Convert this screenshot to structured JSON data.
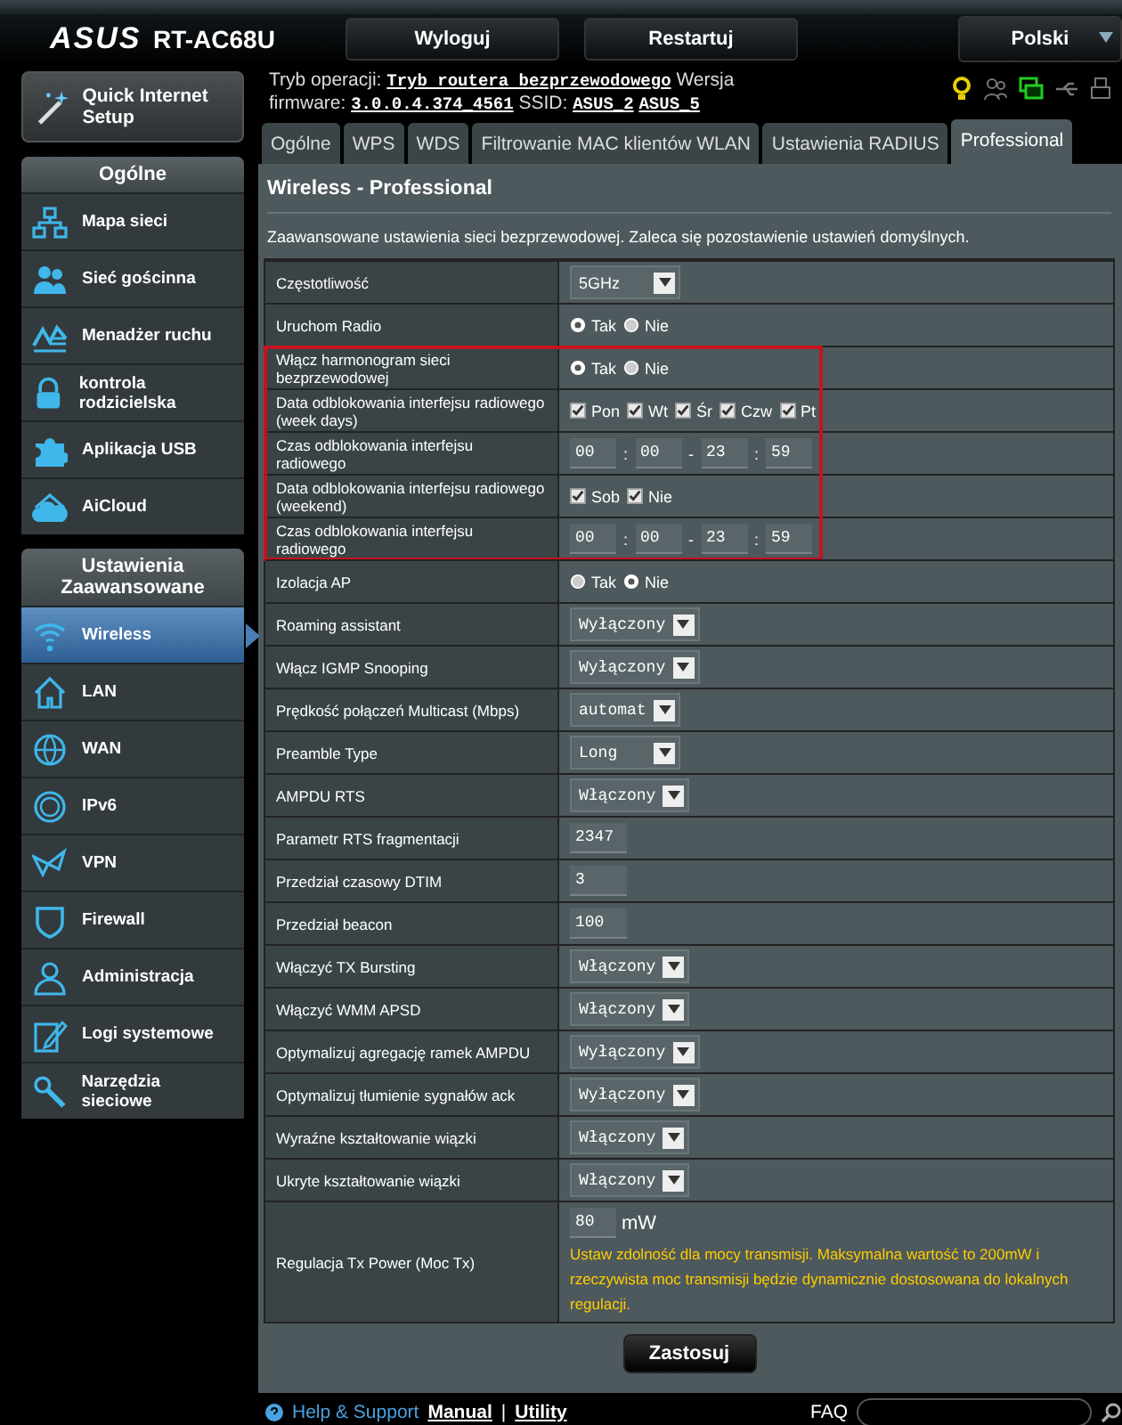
{
  "header": {
    "logo": "ASUS",
    "model": "RT-AC68U",
    "buttons": [
      "Wyloguj",
      "Restartuj"
    ],
    "language": "Polski"
  },
  "info": {
    "mode_label": "Tryb operacji:",
    "mode": "Tryb routera bezprzewodowego",
    "firmware_label_1": "Wersja",
    "firmware_label_2": "firmware:",
    "firmware": "3.0.0.4.374_4561",
    "ssid_label": "SSID:",
    "ssids": [
      "ASUS_2",
      "ASUS_5"
    ]
  },
  "sidebar": {
    "quick_setup": "Quick Internet Setup",
    "sections": [
      {
        "title": "Ogólne",
        "items": [
          {
            "label": "Mapa sieci",
            "selected": false
          },
          {
            "label": "Sieć gościnna",
            "selected": false
          },
          {
            "label": "Menadżer ruchu",
            "selected": false
          },
          {
            "label": "kontrola rodzicielska",
            "selected": false
          },
          {
            "label": "Aplikacja USB",
            "selected": false
          },
          {
            "label": "AiCloud",
            "selected": false
          }
        ]
      },
      {
        "title": "Ustawienia Zaawansowane",
        "items": [
          {
            "label": "Wireless",
            "selected": true
          },
          {
            "label": "LAN",
            "selected": false
          },
          {
            "label": "WAN",
            "selected": false
          },
          {
            "label": "IPv6",
            "selected": false
          },
          {
            "label": "VPN",
            "selected": false
          },
          {
            "label": "Firewall",
            "selected": false
          },
          {
            "label": "Administracja",
            "selected": false
          },
          {
            "label": "Logi systemowe",
            "selected": false
          },
          {
            "label": "Narzędzia sieciowe",
            "selected": false
          }
        ]
      }
    ]
  },
  "tabs": [
    {
      "label": "Ogólne",
      "selected": false
    },
    {
      "label": "WPS",
      "selected": false
    },
    {
      "label": "WDS",
      "selected": false
    },
    {
      "label": "Filtrowanie MAC klientów WLAN",
      "selected": false
    },
    {
      "label": "Ustawienia RADIUS",
      "selected": false
    },
    {
      "label": "Professional",
      "selected": true
    }
  ],
  "page": {
    "title": "Wireless - Professional",
    "description": "Zaawansowane ustawienia sieci bezprzewodowej. Zaleca się pozostawienie ustawień domyślnych.",
    "settings": [
      {
        "label": "Częstotliwość",
        "kind": "select",
        "value": "5GHz",
        "mono": false,
        "highlighted": false
      },
      {
        "label": "Uruchom Radio",
        "kind": "radio",
        "options": [
          {
            "label": "Tak",
            "selected": true
          },
          {
            "label": "Nie",
            "selected": false
          }
        ],
        "highlighted": false
      },
      {
        "label": "Włącz harmonogram sieci bezprzewodowej",
        "kind": "radio",
        "options": [
          {
            "label": "Tak",
            "selected": true
          },
          {
            "label": "Nie",
            "selected": false
          }
        ],
        "highlighted": true
      },
      {
        "label": "Data odblokowania interfejsu radiowego (week days)",
        "kind": "checks",
        "options": [
          {
            "label": "Pon",
            "checked": true
          },
          {
            "label": "Wt",
            "checked": true
          },
          {
            "label": "Śr",
            "checked": true
          },
          {
            "label": "Czw",
            "checked": true
          },
          {
            "label": "Pt",
            "checked": true
          }
        ],
        "highlighted": true
      },
      {
        "label": "Czas odblokowania interfejsu radiowego",
        "kind": "time",
        "values": [
          "00",
          "00",
          "23",
          "59"
        ],
        "separators": [
          ":",
          "-",
          ":"
        ],
        "highlighted": true
      },
      {
        "label": "Data odblokowania interfejsu radiowego (weekend)",
        "kind": "checks",
        "options": [
          {
            "label": "Sob",
            "checked": true
          },
          {
            "label": "Nie",
            "checked": true
          }
        ],
        "highlighted": true
      },
      {
        "label": "Czas odblokowania interfejsu radiowego",
        "kind": "time",
        "values": [
          "00",
          "00",
          "23",
          "59"
        ],
        "separators": [
          ":",
          "-",
          ":"
        ],
        "highlighted": true
      },
      {
        "label": "Izolacja AP",
        "kind": "radio",
        "options": [
          {
            "label": "Tak",
            "selected": false
          },
          {
            "label": "Nie",
            "selected": true
          }
        ],
        "highlighted": false
      },
      {
        "label": "Roaming assistant",
        "kind": "select",
        "value": "Wyłączony",
        "mono": true,
        "highlighted": false
      },
      {
        "label": "Włącz IGMP Snooping",
        "kind": "select",
        "value": "Wyłączony",
        "mono": true,
        "highlighted": false
      },
      {
        "label": "Prędkość połączeń Multicast (Mbps)",
        "kind": "select",
        "value": "automat",
        "mono": true,
        "highlighted": false
      },
      {
        "label": "Preamble Type",
        "kind": "select",
        "value": "Long",
        "mono": true,
        "highlighted": false
      },
      {
        "label": "AMPDU RTS",
        "kind": "select",
        "value": "Włączony",
        "mono": true,
        "highlighted": false
      },
      {
        "label": "Parametr RTS fragmentacji",
        "kind": "text",
        "value": "2347",
        "highlighted": false
      },
      {
        "label": "Przedział czasowy DTIM",
        "kind": "text",
        "value": "3",
        "highlighted": false
      },
      {
        "label": "Przedział beacon",
        "kind": "text",
        "value": "100",
        "highlighted": false
      },
      {
        "label": "Włączyć TX Bursting",
        "kind": "select",
        "value": "Włączony",
        "mono": true,
        "highlighted": false
      },
      {
        "label": "Włączyć WMM APSD",
        "kind": "select",
        "value": "Włączony",
        "mono": true,
        "highlighted": false
      },
      {
        "label": "Optymalizuj agregację ramek AMPDU",
        "kind": "select",
        "value": "Wyłączony",
        "mono": true,
        "highlighted": false
      },
      {
        "label": "Optymalizuj tłumienie sygnałów ack",
        "kind": "select",
        "value": "Wyłączony",
        "mono": true,
        "highlighted": false
      },
      {
        "label": "Wyraźne kształtowanie wiązki",
        "kind": "select",
        "value": "Włączony",
        "mono": true,
        "highlighted": false
      },
      {
        "label": "Ukryte kształtowanie wiązki",
        "kind": "select",
        "value": "Włączony",
        "mono": true,
        "highlighted": false
      },
      {
        "label": "Regulacja Tx Power (Moc Tx)",
        "kind": "power",
        "value": "80",
        "unit": "mW",
        "note": "Ustaw zdolność dla mocy transmisji. Maksymalna wartość to 200mW i rzeczywista moc transmisji będzie dynamicznie dostosowana do lokalnych regulacji.",
        "highlighted": false
      }
    ],
    "apply": "Zastosuj"
  },
  "footer": {
    "help": "Help & Support",
    "links": [
      "Manual",
      "Utility"
    ],
    "divider": "|",
    "faq": "FAQ"
  }
}
